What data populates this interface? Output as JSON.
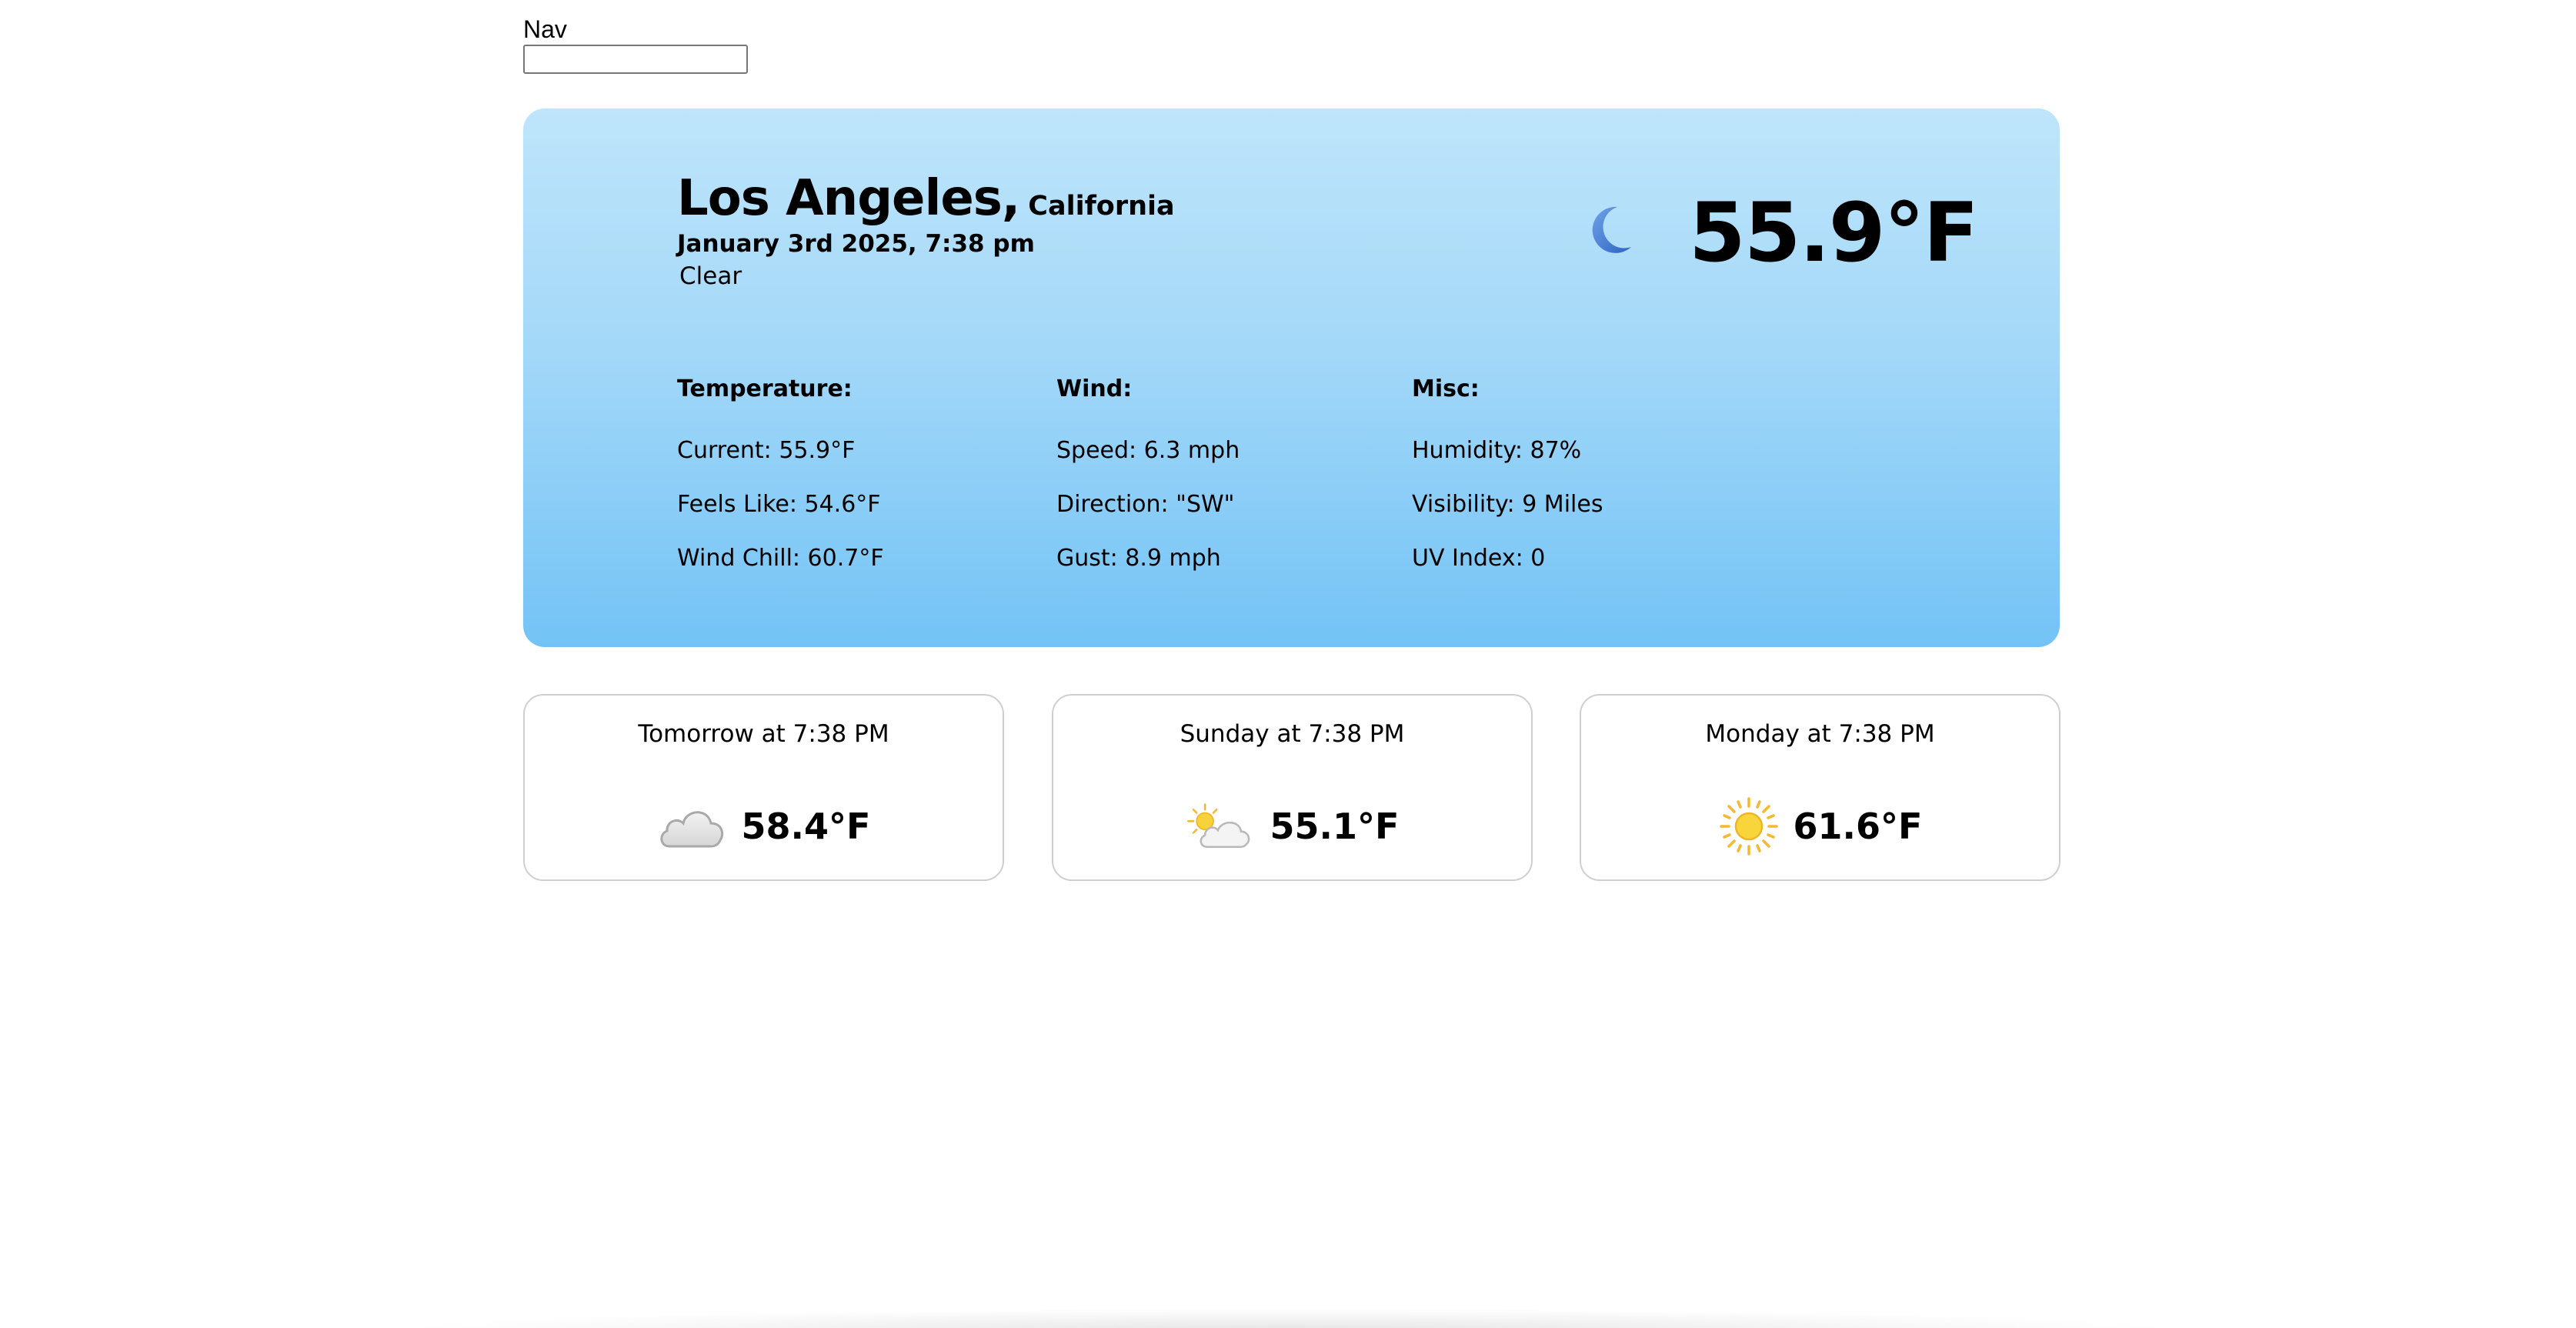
{
  "nav": {
    "label": "Nav",
    "input_value": "",
    "input_placeholder": ""
  },
  "current": {
    "city": "Los Angeles,",
    "state": "California",
    "datetime": "January 3rd 2025, 7:38 pm",
    "condition": "Clear",
    "temperature": "55.9°F",
    "icon": "moon-icon"
  },
  "details": {
    "temperature": {
      "heading": "Temperature:",
      "current": "Current: 55.9°F",
      "feels_like": "Feels Like: 54.6°F",
      "wind_chill": "Wind Chill: 60.7°F"
    },
    "wind": {
      "heading": "Wind:",
      "speed": "Speed: 6.3 mph",
      "direction": "Direction: \"SW\"",
      "gust": "Gust: 8.9 mph"
    },
    "misc": {
      "heading": "Misc:",
      "humidity": "Humidity: 87%",
      "visibility": "Visibility: 9 Miles",
      "uv_index": "UV Index: 0"
    }
  },
  "forecast": [
    {
      "title": "Tomorrow at 7:38 PM",
      "temperature": "58.4°F",
      "icon": "cloud-icon"
    },
    {
      "title": "Sunday at 7:38 PM",
      "temperature": "55.1°F",
      "icon": "partly-cloudy-icon"
    },
    {
      "title": "Monday at 7:38 PM",
      "temperature": "61.6°F",
      "icon": "sun-icon"
    }
  ],
  "colors": {
    "hero_top": "#bfe5fb",
    "hero_bottom": "#73c3f6",
    "moon": "#3a78d6",
    "sun": "#f7c531",
    "cloud": "#e6e6e6"
  }
}
